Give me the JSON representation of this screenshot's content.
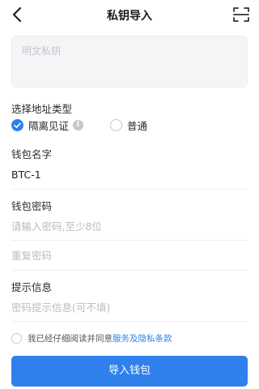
{
  "header": {
    "title": "私钥导入",
    "back_icon": "chevron-left-icon",
    "scan_icon": "scan-icon"
  },
  "private_key": {
    "placeholder": "明文私钥",
    "value": ""
  },
  "address_type": {
    "label": "选择地址类型",
    "options": [
      {
        "label": "隔离见证",
        "selected": true,
        "info_icon": "info-icon"
      },
      {
        "label": "普通",
        "selected": false
      }
    ]
  },
  "wallet_name": {
    "label": "钱包名字",
    "value": "BTC-1"
  },
  "wallet_password": {
    "label": "钱包密码",
    "placeholder": "请输入密码,至少8位",
    "repeat_placeholder": "重复密码"
  },
  "hint": {
    "label": "提示信息",
    "placeholder": "密码提示信息(可不填)"
  },
  "agreement": {
    "checked": false,
    "text": "我已经仔细阅读并同意",
    "link": "服务及隐私条款"
  },
  "submit": {
    "label": "导入钱包"
  },
  "colors": {
    "accent": "#2f80ed",
    "input_bg": "#f4f5f7",
    "placeholder": "#b9bcc2"
  }
}
